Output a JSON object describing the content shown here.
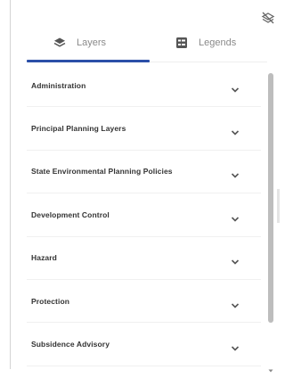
{
  "tabs": [
    {
      "label": "Layers",
      "icon": "layers-icon"
    },
    {
      "label": "Legends",
      "icon": "legend-icon"
    }
  ],
  "layers": [
    {
      "label": "Administration"
    },
    {
      "label": "Principal Planning Layers"
    },
    {
      "label": "State Environmental Planning Policies"
    },
    {
      "label": "Development Control"
    },
    {
      "label": "Hazard"
    },
    {
      "label": "Protection"
    },
    {
      "label": "Subsidence Advisory"
    }
  ],
  "colors": {
    "accent": "#2b4fa8",
    "scrollbar": "#bdbdbd"
  }
}
